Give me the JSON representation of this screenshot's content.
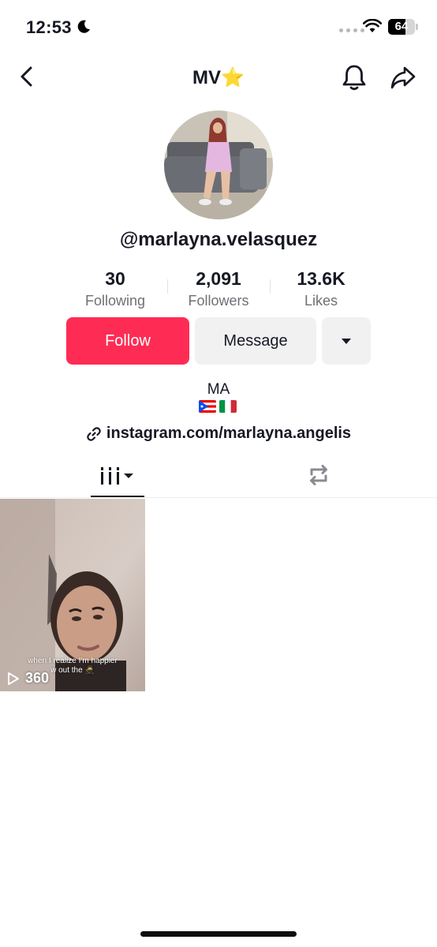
{
  "status_bar": {
    "time": "12:53",
    "battery": "64",
    "battery_level": 0.64
  },
  "header": {
    "title": "MV⭐️"
  },
  "profile": {
    "username": "@marlayna.velasquez",
    "stats": [
      {
        "value": "30",
        "label": "Following"
      },
      {
        "value": "2,091",
        "label": "Followers"
      },
      {
        "value": "13.6K",
        "label": "Likes"
      }
    ],
    "buttons": {
      "follow": "Follow",
      "message": "Message"
    },
    "bio": {
      "name": "MA",
      "flags": [
        "Puerto Rico flag",
        "Italy flag"
      ]
    },
    "link": "instagram.com/marlayna.angelis"
  },
  "tabs": [
    {
      "icon": "videos-grid-icon",
      "active": true
    },
    {
      "icon": "repost-icon",
      "active": false
    }
  ],
  "videos": [
    {
      "caption": "when I realize I'm happier\nw out the 🥷",
      "views": "360"
    }
  ],
  "colors": {
    "accent": "#fe2c55",
    "secondary_button": "#f1f1f2",
    "text": "#161823",
    "muted": "#6f7075"
  }
}
